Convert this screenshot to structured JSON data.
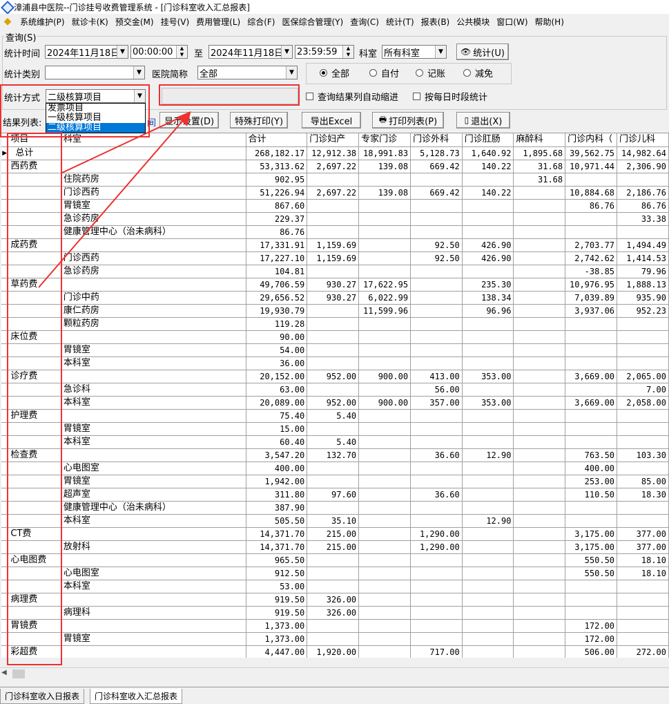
{
  "window": {
    "title": "漳浦县中医院--门诊挂号收费管理系统 - [门诊科室收入汇总报表]"
  },
  "menu": [
    "系统维护(P)",
    "就诊卡(K)",
    "预交金(M)",
    "挂号(V)",
    "费用管理(L)",
    "综合(F)",
    "医保综合管理(Y)",
    "查询(C)",
    "统计(T)",
    "报表(B)",
    "公共模块",
    "窗口(W)",
    "帮助(H)"
  ],
  "query": {
    "group_title": "查询(S)",
    "time_label": "统计时间",
    "start_date": "2024年11月18日",
    "start_time": "00:00:00",
    "to_label": "至",
    "end_date": "2024年11月18日",
    "end_time": "23:59:59",
    "dept_label": "科室",
    "dept_value": "所有科室",
    "stat_button": "统计(U)",
    "category_label": "统计类别",
    "category_value": "",
    "hospital_label": "医院简称",
    "hospital_value": "全部",
    "radios": [
      "全部",
      "自付",
      "记账",
      "减免"
    ],
    "method_label": "统计方式",
    "method_value": "二级核算项目",
    "method_options": [
      "发票项目",
      "一级核算项目",
      "二级核算项目"
    ],
    "chk_auto": "查询结果列自动缩进",
    "chk_daily": "按每日时段统计"
  },
  "toolbar": {
    "result_label": "结果列表:",
    "partial": "间",
    "display_settings": "显示设置(D)",
    "special_print": "特殊打印(Y)",
    "export_excel": "导出Excel",
    "print_list": "打印列表(P)",
    "exit": "退出(X)"
  },
  "grid": {
    "headers": [
      "项目",
      "科室",
      "合计",
      "门诊妇产",
      "专家门诊",
      "门诊外科",
      "门诊肛肠",
      "麻醉科",
      "门诊内科（",
      "门诊儿科"
    ],
    "rows": [
      [
        "总计",
        "",
        "268,182.17",
        "12,912.38",
        "18,991.83",
        "5,128.73",
        "1,640.92",
        "1,895.68",
        "39,562.75",
        "14,982.64"
      ],
      [
        "西药费",
        "",
        "53,313.62",
        "2,697.22",
        "139.08",
        "669.42",
        "140.22",
        "31.68",
        "10,971.44",
        "2,306.90"
      ],
      [
        "",
        "住院药房",
        "902.95",
        "",
        "",
        "",
        "",
        "31.68",
        "",
        ""
      ],
      [
        "",
        "门诊西药",
        "51,226.94",
        "2,697.22",
        "139.08",
        "669.42",
        "140.22",
        "",
        "10,884.68",
        "2,186.76"
      ],
      [
        "",
        "胃镜室",
        "867.60",
        "",
        "",
        "",
        "",
        "",
        "86.76",
        "86.76"
      ],
      [
        "",
        "急诊药房",
        "229.37",
        "",
        "",
        "",
        "",
        "",
        "",
        "33.38"
      ],
      [
        "",
        "健康管理中心（治未病科）",
        "86.76",
        "",
        "",
        "",
        "",
        "",
        "",
        ""
      ],
      [
        "成药费",
        "",
        "17,331.91",
        "1,159.69",
        "",
        "92.50",
        "426.90",
        "",
        "2,703.77",
        "1,494.49"
      ],
      [
        "",
        "门诊西药",
        "17,227.10",
        "1,159.69",
        "",
        "92.50",
        "426.90",
        "",
        "2,742.62",
        "1,414.53"
      ],
      [
        "",
        "急诊药房",
        "104.81",
        "",
        "",
        "",
        "",
        "",
        "-38.85",
        "79.96"
      ],
      [
        "草药费",
        "",
        "49,706.59",
        "930.27",
        "17,622.95",
        "",
        "235.30",
        "",
        "10,976.95",
        "1,888.13"
      ],
      [
        "",
        "门诊中药",
        "29,656.52",
        "930.27",
        "6,022.99",
        "",
        "138.34",
        "",
        "7,039.89",
        "935.90"
      ],
      [
        "",
        "康仁药房",
        "19,930.79",
        "",
        "11,599.96",
        "",
        "96.96",
        "",
        "3,937.06",
        "952.23"
      ],
      [
        "",
        "颗粒药房",
        "119.28",
        "",
        "",
        "",
        "",
        "",
        "",
        ""
      ],
      [
        "床位费",
        "",
        "90.00",
        "",
        "",
        "",
        "",
        "",
        "",
        ""
      ],
      [
        "",
        "胃镜室",
        "54.00",
        "",
        "",
        "",
        "",
        "",
        "",
        ""
      ],
      [
        "",
        "本科室",
        "36.00",
        "",
        "",
        "",
        "",
        "",
        "",
        ""
      ],
      [
        "诊疗费",
        "",
        "20,152.00",
        "952.00",
        "900.00",
        "413.00",
        "353.00",
        "",
        "3,669.00",
        "2,065.00"
      ],
      [
        "",
        "急诊科",
        "63.00",
        "",
        "",
        "56.00",
        "",
        "",
        "",
        "7.00"
      ],
      [
        "",
        "本科室",
        "20,089.00",
        "952.00",
        "900.00",
        "357.00",
        "353.00",
        "",
        "3,669.00",
        "2,058.00"
      ],
      [
        "护理费",
        "",
        "75.40",
        "5.40",
        "",
        "",
        "",
        "",
        "",
        ""
      ],
      [
        "",
        "胃镜室",
        "15.00",
        "",
        "",
        "",
        "",
        "",
        "",
        ""
      ],
      [
        "",
        "本科室",
        "60.40",
        "5.40",
        "",
        "",
        "",
        "",
        "",
        ""
      ],
      [
        "检查费",
        "",
        "3,547.20",
        "132.70",
        "",
        "36.60",
        "12.90",
        "",
        "763.50",
        "103.30"
      ],
      [
        "",
        "心电图室",
        "400.00",
        "",
        "",
        "",
        "",
        "",
        "400.00",
        ""
      ],
      [
        "",
        "胃镜室",
        "1,942.00",
        "",
        "",
        "",
        "",
        "",
        "253.00",
        "85.00"
      ],
      [
        "",
        "超声室",
        "311.80",
        "97.60",
        "",
        "36.60",
        "",
        "",
        "110.50",
        "18.30"
      ],
      [
        "",
        "健康管理中心（治未病科）",
        "387.90",
        "",
        "",
        "",
        "",
        "",
        "",
        ""
      ],
      [
        "",
        "本科室",
        "505.50",
        "35.10",
        "",
        "",
        "12.90",
        "",
        "",
        ""
      ],
      [
        "CT费",
        "",
        "14,371.70",
        "215.00",
        "",
        "1,290.00",
        "",
        "",
        "3,175.00",
        "377.00"
      ],
      [
        "",
        "放射科",
        "14,371.70",
        "215.00",
        "",
        "1,290.00",
        "",
        "",
        "3,175.00",
        "377.00"
      ],
      [
        "心电图费",
        "",
        "965.50",
        "",
        "",
        "",
        "",
        "",
        "550.50",
        "18.10"
      ],
      [
        "",
        "心电图室",
        "912.50",
        "",
        "",
        "",
        "",
        "",
        "550.50",
        "18.10"
      ],
      [
        "",
        "本科室",
        "53.00",
        "",
        "",
        "",
        "",
        "",
        "",
        ""
      ],
      [
        "病理费",
        "",
        "919.50",
        "326.00",
        "",
        "",
        "",
        "",
        "",
        ""
      ],
      [
        "",
        "病理科",
        "919.50",
        "326.00",
        "",
        "",
        "",
        "",
        "",
        ""
      ],
      [
        "胃镜费",
        "",
        "1,373.00",
        "",
        "",
        "",
        "",
        "",
        "172.00",
        ""
      ],
      [
        "",
        "胃镜室",
        "1,373.00",
        "",
        "",
        "",
        "",
        "",
        "172.00",
        ""
      ],
      [
        "彩超费",
        "",
        "4,447.00",
        "1,920.00",
        "",
        "717.00",
        "",
        "",
        "506.00",
        "272.00"
      ]
    ]
  },
  "tabs": [
    "门诊科室收入日报表",
    "门诊科室收入汇总报表"
  ],
  "colors": {
    "highlight": "#ee3030",
    "selection": "#0078d7"
  }
}
